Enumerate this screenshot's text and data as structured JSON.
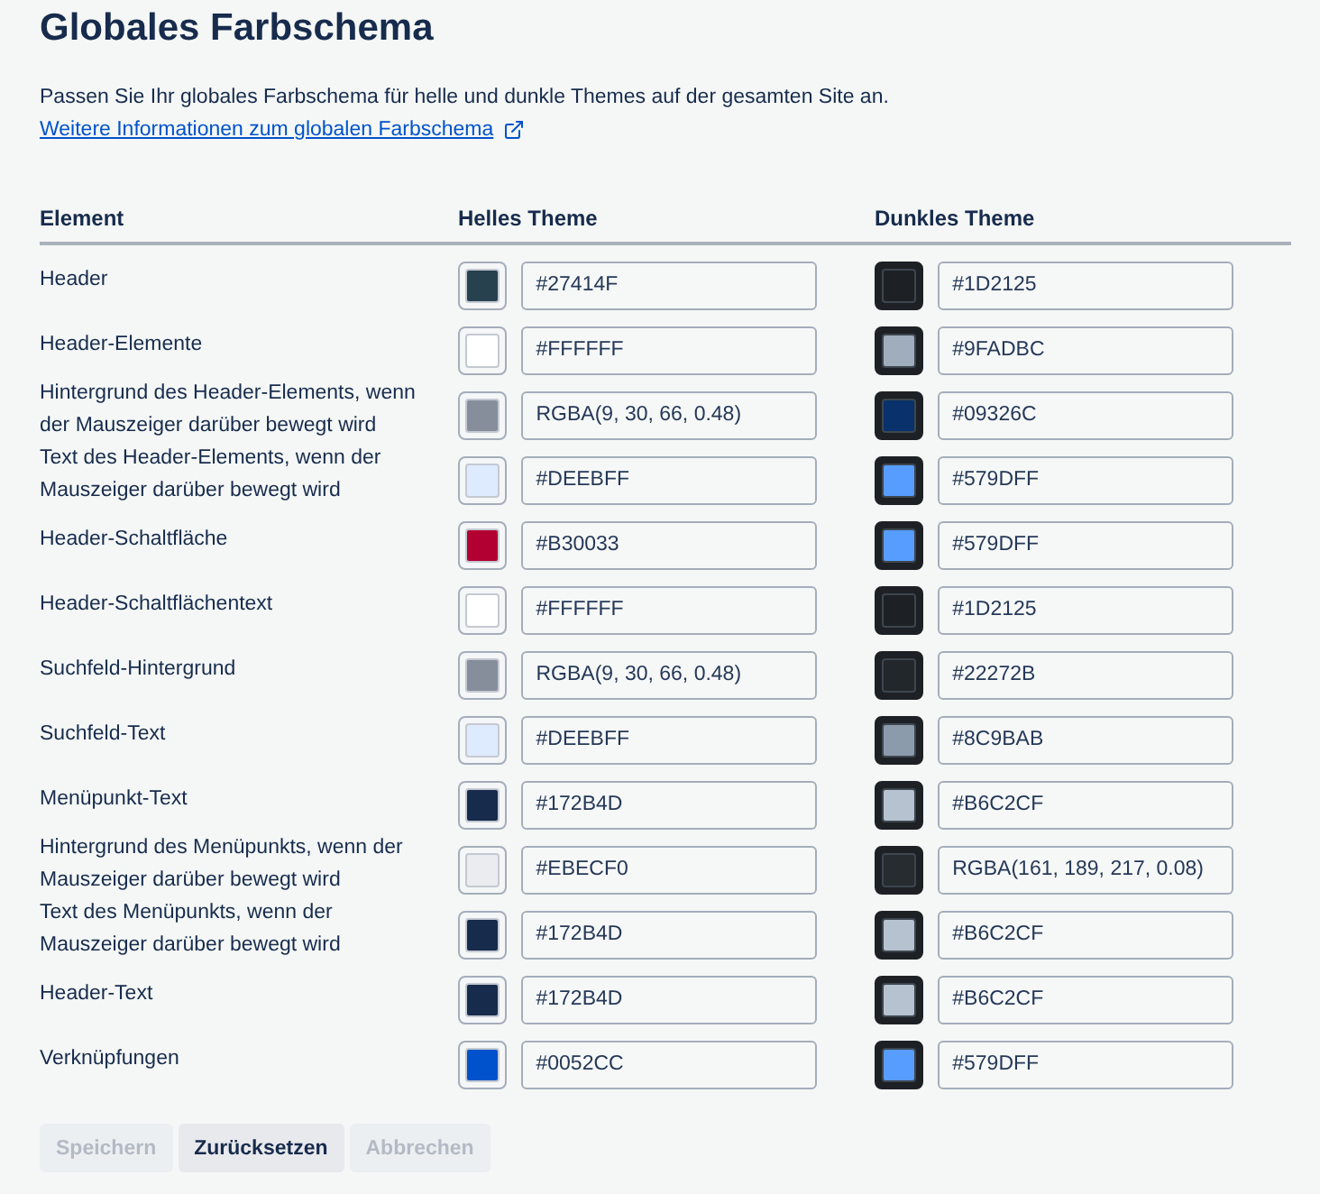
{
  "title": "Globales Farbschema",
  "description": {
    "text": "Passen Sie Ihr globales Farbschema für helle und dunkle Themes auf der gesamten Site an.",
    "link": "Weitere Informationen zum globalen Farbschema"
  },
  "table": {
    "columns": [
      {
        "label": "Element"
      },
      {
        "label": "Helles Theme",
        "kind": "light"
      },
      {
        "label": "Dunkles Theme",
        "kind": "dark"
      }
    ],
    "rows": [
      {
        "element": "Header",
        "values": [
          {
            "text": "#27414F",
            "color": "#27414f"
          },
          {
            "text": "#1D2125",
            "color": "#1d2125"
          }
        ]
      },
      {
        "element": "Header-Elemente",
        "values": [
          {
            "text": "#FFFFFF",
            "color": "#ffffff"
          },
          {
            "text": "#9FADBC",
            "color": "#9fadbc"
          }
        ]
      },
      {
        "element": "Hintergrund des Header-Elements, wenn der Mauszeiger darüber bewegt wird",
        "values": [
          {
            "text": "RGBA(9, 30, 66, 0.48)",
            "color": "#868d9b"
          },
          {
            "text": "#09326C",
            "color": "#09326c"
          }
        ]
      },
      {
        "element": "Text des Header-Elements, wenn der Mauszeiger darüber bewegt wird",
        "values": [
          {
            "text": "#DEEBFF",
            "color": "#deebff"
          },
          {
            "text": "#579DFF",
            "color": "#579dff"
          }
        ]
      },
      {
        "element": "Header-Schaltfläche",
        "values": [
          {
            "text": "#B30033",
            "color": "#b30033"
          },
          {
            "text": "#579DFF",
            "color": "#579dff"
          }
        ]
      },
      {
        "element": "Header-Schaltflächentext",
        "values": [
          {
            "text": "#FFFFFF",
            "color": "#ffffff"
          },
          {
            "text": "#1D2125",
            "color": "#1d2125"
          }
        ]
      },
      {
        "element": "Suchfeld-Hintergrund",
        "values": [
          {
            "text": "RGBA(9, 30, 66, 0.48)",
            "color": "#868d9b"
          },
          {
            "text": "#22272B",
            "color": "#22272b"
          }
        ]
      },
      {
        "element": "Suchfeld-Text",
        "values": [
          {
            "text": "#DEEBFF",
            "color": "#deebff"
          },
          {
            "text": "#8C9BAB",
            "color": "#8c9bab"
          }
        ]
      },
      {
        "element": "Menüpunkt-Text",
        "values": [
          {
            "text": "#172B4D",
            "color": "#172b4d"
          },
          {
            "text": "#B6C2CF",
            "color": "#b6c2cf"
          }
        ]
      },
      {
        "element": "Hintergrund des Menüpunkts, wenn der Mauszeiger darüber bewegt wird",
        "values": [
          {
            "text": "#EBECF0",
            "color": "#ebecf0"
          },
          {
            "text": "RGBA(161, 189, 217, 0.08)",
            "color": "#262c30"
          }
        ]
      },
      {
        "element": "Text des Menüpunkts, wenn der Mauszeiger darüber bewegt wird",
        "values": [
          {
            "text": "#172B4D",
            "color": "#172b4d"
          },
          {
            "text": "#B6C2CF",
            "color": "#b6c2cf"
          }
        ]
      },
      {
        "element": "Header-Text",
        "values": [
          {
            "text": "#172B4D",
            "color": "#172b4d"
          },
          {
            "text": "#B6C2CF",
            "color": "#b6c2cf"
          }
        ]
      },
      {
        "element": "Verknüpfungen",
        "values": [
          {
            "text": "#0052CC",
            "color": "#0052cc"
          },
          {
            "text": "#579DFF",
            "color": "#579dff"
          }
        ]
      }
    ]
  },
  "buttons": [
    {
      "label": "Speichern",
      "disabled": true
    },
    {
      "label": "Zurücksetzen",
      "disabled": false
    },
    {
      "label": "Abbrechen",
      "disabled": true
    }
  ]
}
